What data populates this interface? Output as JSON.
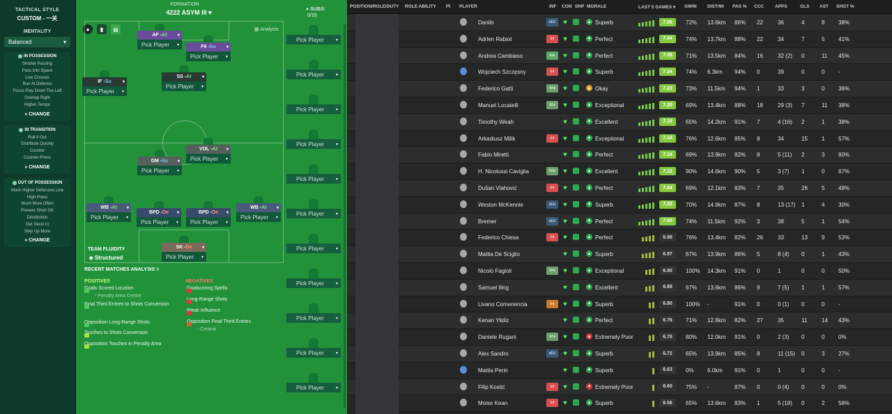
{
  "sidebar": {
    "title": "TACTICAL STYLE",
    "style": "CUSTOM - 一关",
    "mentality_label": "MENTALITY",
    "mentality_value": "Balanced",
    "in_possession": {
      "header": "IN POSSESSION",
      "items": [
        "Shorter Passing",
        "Pass Into Space",
        "Low Crosses",
        "Run At Defence",
        "Focus Play Down The Left",
        "Overlap Right",
        "Higher Tempo"
      ],
      "change": "CHANGE"
    },
    "in_transition": {
      "header": "IN TRANSITION",
      "items": [
        "Roll It Out",
        "Distribute Quickly",
        "Counter",
        "Counter-Press"
      ],
      "change": "CHANGE"
    },
    "out_of_possession": {
      "header": "OUT OF POSSESSION",
      "items": [
        "Much Higher Defensive Line",
        "High Press",
        "Much More Often",
        "Prevent Short GK",
        "Distribution",
        "Get Stuck In",
        "Step Up More"
      ],
      "change": "CHANGE"
    }
  },
  "pitch": {
    "formation_label": "FORMATION",
    "formation_name": "4222 ASYM III",
    "analysis_label": "Analysis",
    "pick_label": "Pick Player",
    "positions": [
      {
        "role": "AF",
        "duty": "At"
      },
      {
        "role": "F9",
        "duty": "Su"
      },
      {
        "role": "IF",
        "duty": "Su"
      },
      {
        "role": "SS",
        "duty": "At"
      },
      {
        "role": "VOL",
        "duty": "At"
      },
      {
        "role": "DM",
        "duty": "Su"
      },
      {
        "role": "WB",
        "duty": "At"
      },
      {
        "role": "BPD",
        "duty": "De"
      },
      {
        "role": "BPD",
        "duty": "De"
      },
      {
        "role": "WB",
        "duty": "At"
      },
      {
        "role": "SK",
        "duty": "De"
      }
    ],
    "team_fluidity_label": "TEAM FLUIDITY",
    "team_fluidity_value": "Structured",
    "recent_analysis_label": "RECENT MATCHES ANALYSIS >",
    "positives_label": "POSITIVES",
    "negatives_label": "NEGATIVES",
    "positives": [
      {
        "text": "Goals Scored Location",
        "sub": "- Penalty Area Centre"
      },
      {
        "text": "Final Third Entries to Shots Conversion",
        "sub": ""
      },
      {
        "text": "Opposition Long-Range Shots",
        "sub": ""
      },
      {
        "text": "Touches to Shots Conversion",
        "sub": ""
      },
      {
        "text": "Opposition Touches in Penalty Area",
        "sub": ""
      }
    ],
    "negatives": [
      {
        "text": "Goalscoring Spells",
        "sub": ""
      },
      {
        "text": "Long-Range Shots",
        "sub": ""
      },
      {
        "text": "Weak Influence",
        "sub": ""
      },
      {
        "text": "Opposition Final Third Entries",
        "sub": "- Central"
      }
    ]
  },
  "subs": {
    "label": "SUBS:",
    "count": "0/15",
    "pick_label": "Pick Player"
  },
  "table": {
    "headers": [
      "POSITION/ROLE/DUTY",
      "ROLE ABILITY",
      "PI",
      "PLAYER",
      "INF",
      "CON",
      "SHP",
      "MORALE",
      "LAST 5 GAMES",
      "GWIN",
      "DIST/90",
      "PAS %",
      "CCC",
      "APPS",
      "GLS",
      "AST",
      "SHOT %"
    ],
    "rows": [
      {
        "pos": "-",
        "name": "Danilo",
        "inf": "nEU",
        "infc": "n",
        "morale": "Superb",
        "mc": "#2eaa4e",
        "rating": "7.56",
        "hi": true,
        "gwin": "72%",
        "dist": "13.6km",
        "pas": "86%",
        "ccc": "22",
        "apps": "36",
        "gls": "4",
        "ast": "8",
        "shot": "38%"
      },
      {
        "pos": "-",
        "name": "Adrien Rabiot",
        "inf": "Inf",
        "infc": "i",
        "morale": "Perfect",
        "mc": "#2eaa4e",
        "rating": "7.44",
        "hi": true,
        "gwin": "74%",
        "dist": "13.7km",
        "pas": "88%",
        "ccc": "22",
        "apps": "34",
        "gls": "7",
        "ast": "5",
        "shot": "41%"
      },
      {
        "pos": "-",
        "name": "Andrea Cambiaso",
        "inf": "Ask",
        "infc": "a",
        "morale": "Perfect",
        "mc": "#2eaa4e",
        "rating": "7.36",
        "hi": true,
        "gwin": "71%",
        "dist": "13.5km",
        "pas": "84%",
        "ccc": "16",
        "apps": "32 (2)",
        "gls": "0",
        "ast": "11",
        "shot": "45%"
      },
      {
        "pos": "-",
        "name": "Wojciech Szczęsny",
        "inf": "Inf",
        "infc": "i",
        "morale": "Superb",
        "mc": "#2eaa4e",
        "rating": "7.24",
        "hi": true,
        "gwin": "74%",
        "dist": "6.3km",
        "pas": "94%",
        "ccc": "0",
        "apps": "39",
        "gls": "0",
        "ast": "0",
        "shot": "-",
        "blue": true
      },
      {
        "pos": "-",
        "name": "Federico Gatti",
        "inf": "Wnt",
        "infc": "w",
        "morale": "Okay",
        "mc": "#e0a020",
        "rating": "7.22",
        "hi": true,
        "gwin": "73%",
        "dist": "11.5km",
        "pas": "94%",
        "ccc": "1",
        "apps": "33",
        "gls": "3",
        "ast": "0",
        "shot": "36%"
      },
      {
        "pos": "-",
        "name": "Manuel Locatelli",
        "inf": "Wnt",
        "infc": "w",
        "morale": "Exceptional",
        "mc": "#2eaa4e",
        "rating": "7.20",
        "hi": true,
        "gwin": "69%",
        "dist": "13.4km",
        "pas": "88%",
        "ccc": "18",
        "apps": "29 (3)",
        "gls": "7",
        "ast": "11",
        "shot": "38%"
      },
      {
        "pos": "-",
        "name": "Timothy Weah",
        "inf": "",
        "infc": "",
        "morale": "Excellent",
        "mc": "#2eaa4e",
        "rating": "7.16",
        "hi": true,
        "gwin": "65%",
        "dist": "14.2km",
        "pas": "91%",
        "ccc": "7",
        "apps": "4 (16)",
        "gls": "2",
        "ast": "1",
        "shot": "38%"
      },
      {
        "pos": "-",
        "name": "Arkadiusz Milik",
        "inf": "Inf",
        "infc": "i",
        "morale": "Exceptional",
        "mc": "#2eaa4e",
        "rating": "7.14",
        "hi": true,
        "gwin": "76%",
        "dist": "12.6km",
        "pas": "85%",
        "ccc": "8",
        "apps": "34",
        "gls": "15",
        "ast": "1",
        "shot": "57%"
      },
      {
        "pos": "-",
        "name": "Fabio Miretti",
        "inf": "",
        "infc": "",
        "morale": "Perfect",
        "mc": "#2eaa4e",
        "rating": "7.14",
        "hi": true,
        "gwin": "69%",
        "dist": "13.9km",
        "pas": "82%",
        "ccc": "8",
        "apps": "5 (11)",
        "gls": "2",
        "ast": "3",
        "shot": "60%"
      },
      {
        "pos": "-",
        "name": "H. Nicolussi Caviglia",
        "inf": "Wnt",
        "infc": "w",
        "morale": "Excellent",
        "mc": "#2eaa4e",
        "rating": "7.12",
        "hi": true,
        "gwin": "90%",
        "dist": "14.6km",
        "pas": "90%",
        "ccc": "5",
        "apps": "3 (7)",
        "gls": "1",
        "ast": "0",
        "shot": "67%"
      },
      {
        "pos": "-",
        "name": "Dušan Vlahović",
        "inf": "Inf",
        "infc": "i",
        "morale": "Perfect",
        "mc": "#2eaa4e",
        "rating": "7.04",
        "hi": true,
        "gwin": "69%",
        "dist": "12.1km",
        "pas": "83%",
        "ccc": "7",
        "apps": "35",
        "gls": "26",
        "ast": "5",
        "shot": "49%"
      },
      {
        "pos": "-",
        "name": "Weston McKennie",
        "inf": "nEU",
        "infc": "n",
        "morale": "Superb",
        "mc": "#2eaa4e",
        "rating": "7.02",
        "hi": true,
        "gwin": "70%",
        "dist": "14.9km",
        "pas": "87%",
        "ccc": "8",
        "apps": "13 (17)",
        "gls": "1",
        "ast": "4",
        "shot": "30%"
      },
      {
        "pos": "-",
        "name": "Bremer",
        "inf": "nEU",
        "infc": "n",
        "morale": "Perfect",
        "mc": "#2eaa4e",
        "rating": "7.00",
        "hi": true,
        "gwin": "74%",
        "dist": "11.5km",
        "pas": "92%",
        "ccc": "3",
        "apps": "38",
        "gls": "5",
        "ast": "1",
        "shot": "54%"
      },
      {
        "pos": "-",
        "name": "Federico Chiesa",
        "inf": "Inf",
        "infc": "i",
        "morale": "Perfect",
        "mc": "#2eaa4e",
        "rating": "6.98",
        "hi": false,
        "gwin": "76%",
        "dist": "13.4km",
        "pas": "82%",
        "ccc": "26",
        "apps": "33",
        "gls": "13",
        "ast": "9",
        "shot": "53%"
      },
      {
        "pos": "-",
        "name": "Mattia De Sciglio",
        "inf": "",
        "infc": "",
        "morale": "Superb",
        "mc": "#2eaa4e",
        "rating": "6.97",
        "hi": false,
        "gwin": "67%",
        "dist": "13.9km",
        "pas": "86%",
        "ccc": "5",
        "apps": "8 (4)",
        "gls": "0",
        "ast": "1",
        "shot": "43%"
      },
      {
        "pos": "-",
        "name": "Nicolò Fagioli",
        "inf": "Wnt",
        "infc": "w",
        "morale": "Exceptional",
        "mc": "#2eaa4e",
        "rating": "6.90",
        "hi": false,
        "gwin": "100%",
        "dist": "14.3km",
        "pas": "91%",
        "ccc": "0",
        "apps": "1",
        "gls": "0",
        "ast": "0",
        "shot": "50%"
      },
      {
        "pos": "-",
        "name": "Samuel Iling",
        "inf": "",
        "infc": "",
        "morale": "Excellent",
        "mc": "#2eaa4e",
        "rating": "6.88",
        "hi": false,
        "gwin": "67%",
        "dist": "13.6km",
        "pas": "86%",
        "ccc": "9",
        "apps": "7 (5)",
        "gls": "1",
        "ast": "1",
        "shot": "57%"
      },
      {
        "pos": "-",
        "name": "Livano Comenencia",
        "inf": "Inj",
        "infc": "b",
        "morale": "Superb",
        "mc": "#2eaa4e",
        "rating": "6.80",
        "hi": false,
        "gwin": "100%",
        "dist": "-",
        "pas": "91%",
        "ccc": "0",
        "apps": "0 (1)",
        "gls": "0",
        "ast": "0",
        "shot": "-"
      },
      {
        "pos": "-",
        "name": "Kenan Yildiz",
        "inf": "",
        "infc": "",
        "morale": "Perfect",
        "mc": "#2eaa4e",
        "rating": "6.76",
        "hi": false,
        "gwin": "71%",
        "dist": "12.8km",
        "pas": "82%",
        "ccc": "27",
        "apps": "35",
        "gls": "11",
        "ast": "14",
        "shot": "43%"
      },
      {
        "pos": "-",
        "name": "Daniele Rugani",
        "inf": "Wnt",
        "infc": "w",
        "morale": "Extremely Poor",
        "mc": "#d83a3a",
        "rating": "6.75",
        "hi": false,
        "gwin": "80%",
        "dist": "12.0km",
        "pas": "91%",
        "ccc": "0",
        "apps": "2 (3)",
        "gls": "0",
        "ast": "0",
        "shot": "0%"
      },
      {
        "pos": "-",
        "name": "Alex Sandro",
        "inf": "nEU",
        "infc": "n",
        "morale": "Superb",
        "mc": "#2eaa4e",
        "rating": "6.72",
        "hi": false,
        "gwin": "65%",
        "dist": "13.9km",
        "pas": "85%",
        "ccc": "8",
        "apps": "11 (15)",
        "gls": "0",
        "ast": "3",
        "shot": "27%"
      },
      {
        "pos": "-",
        "name": "Mattia Perin",
        "inf": "",
        "infc": "",
        "morale": "Superb",
        "mc": "#2eaa4e",
        "rating": "6.63",
        "hi": false,
        "gwin": "0%",
        "dist": "6.0km",
        "pas": "91%",
        "ccc": "0",
        "apps": "1",
        "gls": "0",
        "ast": "0",
        "shot": "-",
        "blue": true
      },
      {
        "pos": "-",
        "name": "Filip Kostić",
        "inf": "Inf",
        "infc": "i",
        "morale": "Extremely Poor",
        "mc": "#d83a3a",
        "rating": "6.60",
        "hi": false,
        "gwin": "75%",
        "dist": "-",
        "pas": "87%",
        "ccc": "0",
        "apps": "0 (4)",
        "gls": "0",
        "ast": "0",
        "shot": "0%"
      },
      {
        "pos": "-",
        "name": "Moise Kean",
        "inf": "Inf",
        "infc": "i",
        "morale": "Superb",
        "mc": "#2eaa4e",
        "rating": "6.56",
        "hi": false,
        "gwin": "65%",
        "dist": "13.6km",
        "pas": "83%",
        "ccc": "1",
        "apps": "5 (18)",
        "gls": "0",
        "ast": "2",
        "shot": "58%"
      }
    ]
  },
  "colors": {
    "pitch": "#22923a",
    "accent": "#86c840",
    "negative": "#d83a3a"
  }
}
